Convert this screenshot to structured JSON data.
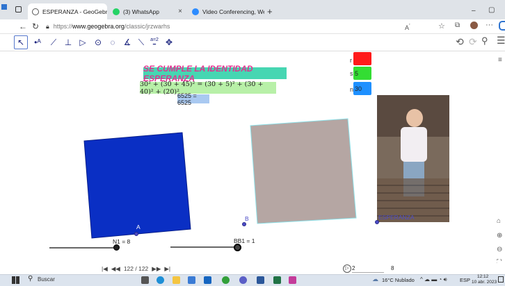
{
  "browser": {
    "tabs": [
      {
        "title": "ESPERANZA - GeoGebra",
        "active": true
      },
      {
        "title": "(3) WhatsApp",
        "active": false
      },
      {
        "title": "Video Conferencing, Web Confe",
        "active": false
      }
    ],
    "new_tab": "+",
    "close_glyph": "×",
    "url_prefix": "https://",
    "url_domain": "www.geogebra.org",
    "url_path": "/classic/jrzwarhs",
    "window_controls": {
      "minimize": "–",
      "restore": "▢"
    }
  },
  "toolbar": {
    "icons": [
      "move-tool-icon",
      "point-tool-icon",
      "line-tool-icon",
      "perpendicular-tool-icon",
      "polygon-tool-icon",
      "circle-tool-icon",
      "ellipse-tool-icon",
      "angle-tool-icon",
      "reflect-tool-icon",
      "slider-tool-icon",
      "move-view-tool-icon"
    ],
    "slider_tool_label": "a=2",
    "undo": "⟲",
    "redo": "⟳",
    "search": "🔍",
    "menu": "☰"
  },
  "graphics": {
    "title": "SE CUMPLE LA IDENTIDAD ESPERANZA",
    "formula": "30² + (30 + 45)² = (30 + 5)² + (30 + 40)² + (20)²",
    "result": "6525 = 6525",
    "params": [
      {
        "label": "r",
        "value": "",
        "color": "#ff1a1a"
      },
      {
        "label": "s",
        "value": "5",
        "color": "#33dd33"
      },
      {
        "label": "n",
        "value": "30",
        "color": "#1e90ff"
      }
    ],
    "point_A_label": "A",
    "point_B_label": "B",
    "photo_caption": "ESPERANZA",
    "slider1_label": "N1 = 8",
    "slider2_label": "BB1 = 1",
    "colors": {
      "blue_square": "#0a2fc4",
      "gray_square": "#b5a6a3",
      "title_bg": "#46d6b2",
      "title_text": "#e0338f"
    }
  },
  "playbar": {
    "first": "|◀",
    "prev": "◀◀",
    "counter": "122 / 122",
    "next": "▶▶",
    "last": "▶|",
    "play": "▷",
    "input_value": "2",
    "speed_value": "8"
  },
  "taskbar": {
    "search_placeholder": "Buscar",
    "weather": "16°C  Nublado",
    "lang": "ESP",
    "time": "12:12",
    "date": "10 abr. 2023"
  }
}
